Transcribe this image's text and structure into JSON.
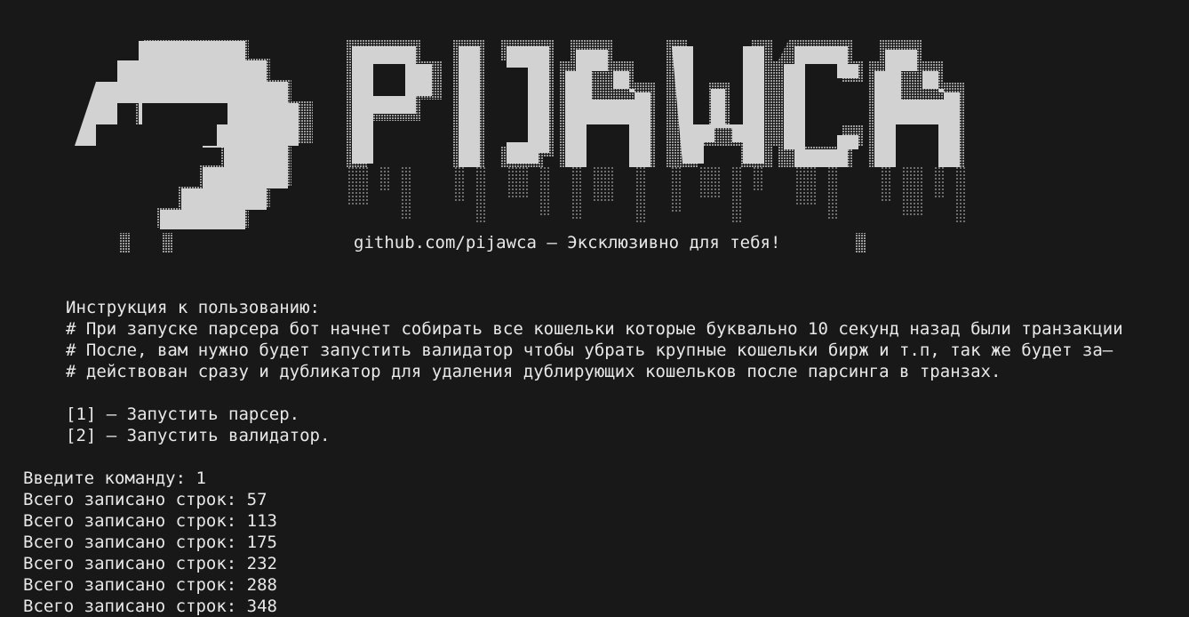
{
  "banner": {
    "logo_word": "PIJAWCA",
    "tagline": "github.com/pijawca – Эксклюзивно для тебя!"
  },
  "instructions": {
    "heading": "Инструкция к пользованию:",
    "lines": [
      "# При запуске парсера бот начнет собирать все кошельки которые буквально 10 секунд назад были транзакции",
      "# После, вам нужно будет запустить валидатор чтобы убрать крупные кошельки бирж и т.п, так же будет за–",
      "# действован сразу и дубликатор для удаления дублирующих кошельков после парсинга в транзах."
    ]
  },
  "menu": {
    "items": [
      "[1] – Запустить парсер.",
      "[2] – Запустить валидатор."
    ]
  },
  "console": {
    "prompt": "Введите команду: 1",
    "output": [
      "Всего записано строк: 57",
      "Всего записано строк: 113",
      "Всего записано строк: 175",
      "Всего записано строк: 232",
      "Всего записано строк: 288",
      "Всего записано строк: 348"
    ]
  },
  "colors": {
    "background": "#181818",
    "text": "#e8e8e8",
    "art_solid": "#d2d2d2",
    "art_shade": "#8a8a8a"
  }
}
